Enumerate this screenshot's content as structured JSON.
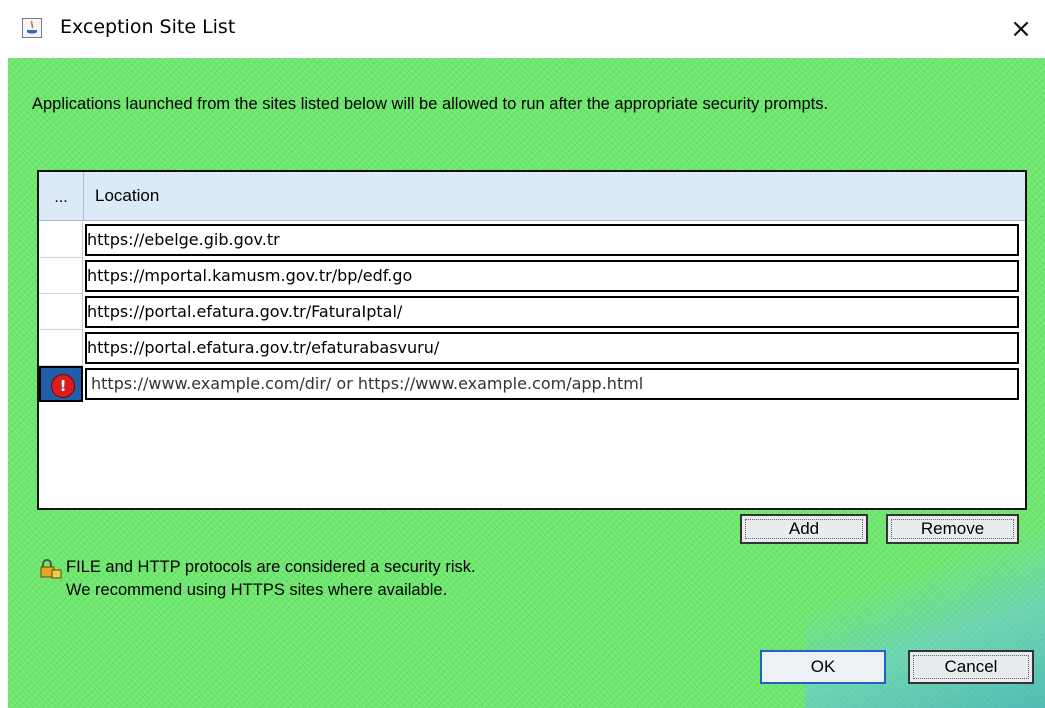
{
  "window": {
    "title": "Exception Site List",
    "close_symbol": "×"
  },
  "intro_text": "Applications launched from the sites listed below will be allowed to run after the appropriate security prompts.",
  "table": {
    "columns": [
      "...",
      "Location"
    ],
    "rows": [
      "https://ebelge.gib.gov.tr",
      "https://mportal.kamusm.gov.tr/bp/edf.go",
      "https://portal.efatura.gov.tr/FaturaIptal/",
      "https://portal.efatura.gov.tr/efaturabasvuru/"
    ],
    "edit_row": {
      "warning_symbol": "!",
      "placeholder": "https://www.example.com/dir/ or https://www.example.com/app.html"
    }
  },
  "buttons": {
    "add": "Add",
    "remove": "Remove",
    "ok": "OK",
    "cancel": "Cancel"
  },
  "security_note": {
    "line1": "FILE and HTTP protocols are considered a security risk.",
    "line2": "We recommend using HTTPS sites where available."
  },
  "icons": {
    "app": "java-icon",
    "close": "close-icon",
    "warning": "warning-icon",
    "security": "lock-icon"
  },
  "colors": {
    "background": "#6ee76e",
    "header": "#dce9f6",
    "warning": "#d81e1e",
    "default_button_border": "#1e63c8"
  }
}
